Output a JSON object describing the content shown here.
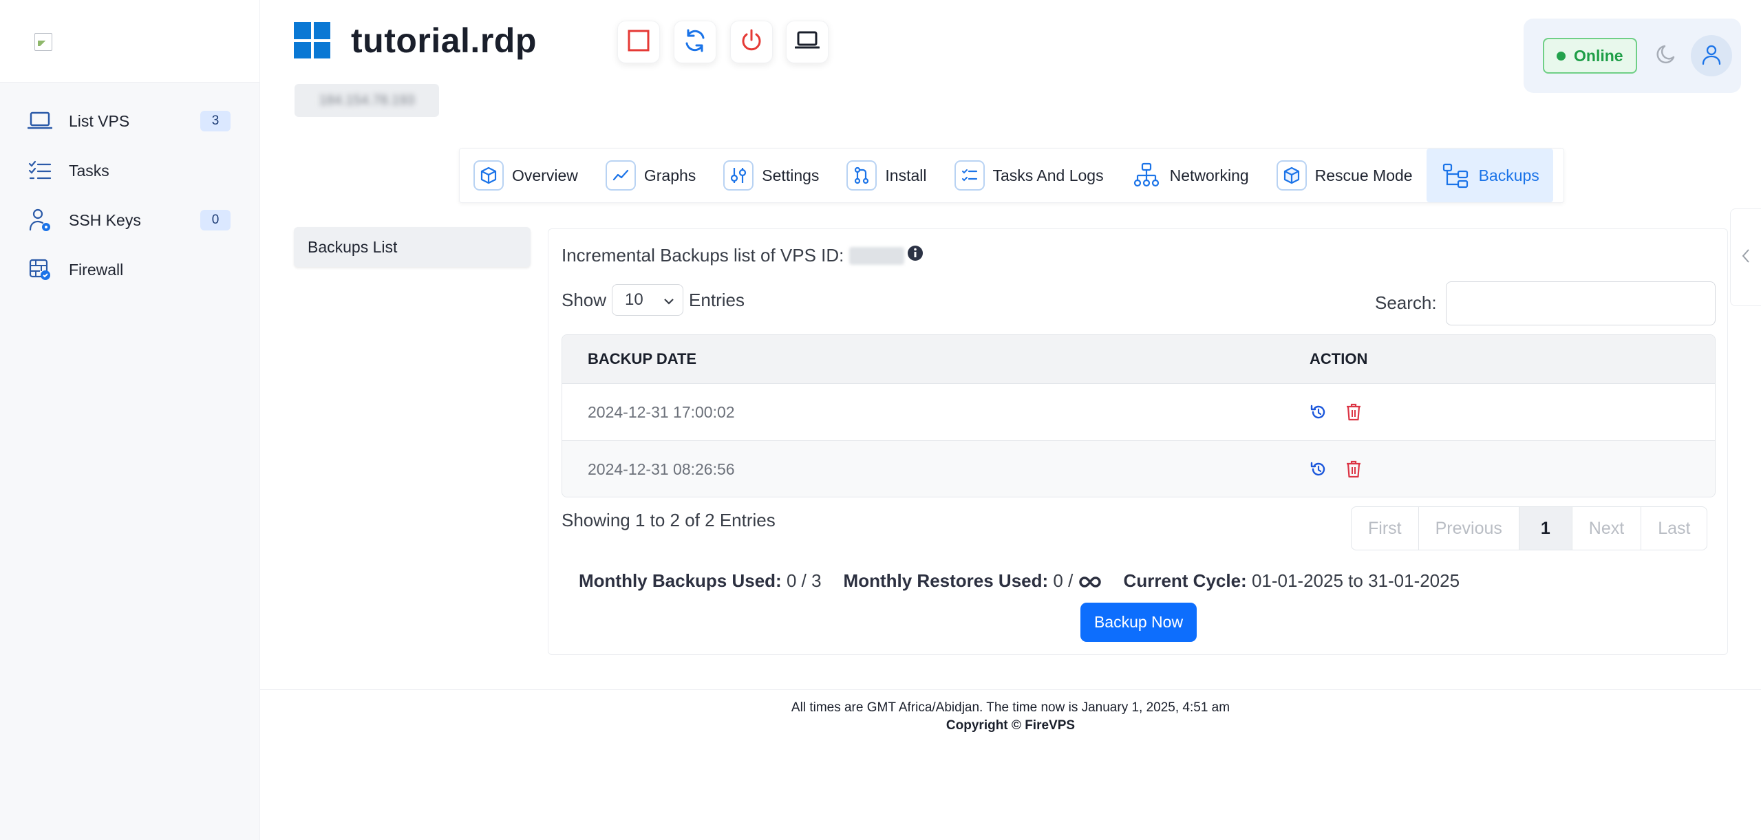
{
  "sidebar": {
    "items": [
      {
        "label": "List VPS",
        "badge": "3",
        "icon": "laptop-icon"
      },
      {
        "label": "Tasks",
        "badge": null,
        "icon": "checklist-icon"
      },
      {
        "label": "SSH Keys",
        "badge": "0",
        "icon": "user-key-icon"
      },
      {
        "label": "Firewall",
        "badge": null,
        "icon": "firewall-icon"
      }
    ]
  },
  "header": {
    "title": "tutorial.rdp",
    "ip_blurred": "184.154.78.193",
    "status": "Online"
  },
  "tabs": [
    {
      "label": "Overview",
      "icon": "cube-icon"
    },
    {
      "label": "Graphs",
      "icon": "chart-line-icon"
    },
    {
      "label": "Settings",
      "icon": "sliders-icon"
    },
    {
      "label": "Install",
      "icon": "git-pull-icon"
    },
    {
      "label": "Tasks And Logs",
      "icon": "list-check-icon"
    },
    {
      "label": "Networking",
      "icon": "network-icon"
    },
    {
      "label": "Rescue Mode",
      "icon": "box-icon"
    },
    {
      "label": "Backups",
      "icon": "hierarchy-icon",
      "active": true
    }
  ],
  "submenu": {
    "backups_list": "Backups List"
  },
  "backups": {
    "title": "Incremental Backups list of VPS ID:",
    "show_label": "Show",
    "entries_value": "10",
    "entries_label": "Entries",
    "search_label": "Search:",
    "search_value": "",
    "columns": [
      "BACKUP DATE",
      "ACTION"
    ],
    "rows": [
      {
        "date": "2024-12-31 17:00:02"
      },
      {
        "date": "2024-12-31 08:26:56"
      }
    ],
    "showing": "Showing 1 to 2 of 2 Entries",
    "pagination": [
      "First",
      "Previous",
      "1",
      "Next",
      "Last"
    ],
    "monthly_backups_label": "Monthly Backups Used:",
    "monthly_backups_value": "0 / 3",
    "monthly_restores_label": "Monthly Restores Used:",
    "monthly_restores_value": "0 /",
    "current_cycle_label": "Current Cycle:",
    "current_cycle_value": "01-01-2025 to 31-01-2025",
    "backup_now": "Backup Now"
  },
  "footer": {
    "timezone": "All times are GMT Africa/Abidjan. The time now is January 1, 2025, 4:51 am",
    "copyright": "Copyright © FireVPS"
  },
  "colors": {
    "accent": "#0d6efd",
    "online": "#1e9e47",
    "danger": "#dc3545",
    "windows": "#0a78d4"
  }
}
